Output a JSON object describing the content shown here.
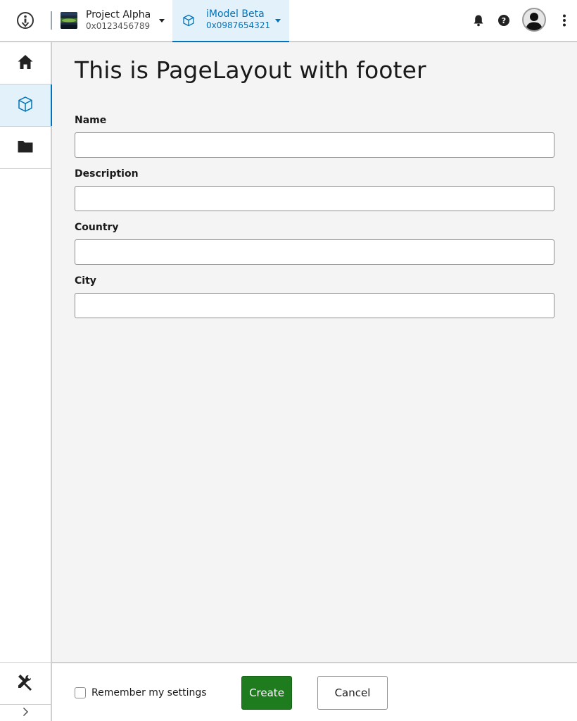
{
  "header": {
    "project": {
      "title": "Project Alpha",
      "id": "0x0123456789"
    },
    "imodel": {
      "title": "iModel Beta",
      "id": "0x0987654321"
    },
    "icons": [
      "info-logo-icon",
      "project-thumbnail",
      "cube-icon",
      "bell-icon",
      "help-icon",
      "avatar",
      "more-vertical-icon"
    ]
  },
  "sidebar": {
    "items": [
      {
        "name": "home",
        "icon": "home-icon"
      },
      {
        "name": "imodel",
        "icon": "cube-icon",
        "active": true
      },
      {
        "name": "folder",
        "icon": "folder-icon"
      }
    ],
    "bottom": {
      "icon": "tools-icon"
    },
    "expand": {
      "icon": "chevron-right-icon"
    }
  },
  "main": {
    "title": "This is PageLayout with footer",
    "fields": [
      {
        "label": "Name",
        "value": ""
      },
      {
        "label": "Description",
        "value": ""
      },
      {
        "label": "Country",
        "value": ""
      },
      {
        "label": "City",
        "value": ""
      }
    ]
  },
  "footer": {
    "remember_label": "Remember my settings",
    "remember_checked": false,
    "create_label": "Create",
    "cancel_label": "Cancel"
  },
  "colors": {
    "accent": "#0073ba",
    "selected_bg": "#e3f1fb",
    "primary_button": "#1e7b1e"
  }
}
